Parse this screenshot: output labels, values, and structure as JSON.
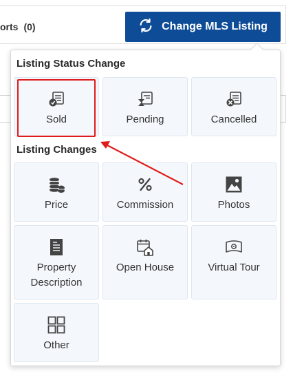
{
  "header": {
    "reports_label": "orts",
    "reports_count": "(0)",
    "change_button_label": "Change MLS Listing"
  },
  "popup": {
    "status_section_title": "Listing Status Change",
    "status_items": [
      {
        "label": "Sold",
        "icon": "sold-icon"
      },
      {
        "label": "Pending",
        "icon": "pending-icon"
      },
      {
        "label": "Cancelled",
        "icon": "cancelled-icon"
      }
    ],
    "changes_section_title": "Listing Changes",
    "change_items": [
      {
        "label": "Price",
        "icon": "coins-icon"
      },
      {
        "label": "Commission",
        "icon": "percent-icon"
      },
      {
        "label": "Photos",
        "icon": "photo-icon"
      },
      {
        "label": "Property\nDescription",
        "line1": "Property",
        "line2": "Description",
        "icon": "document-icon"
      },
      {
        "label": "Open House",
        "icon": "open-house-icon"
      },
      {
        "label": "Virtual Tour",
        "icon": "virtual-tour-icon"
      },
      {
        "label": "Other",
        "icon": "grid-icon"
      }
    ]
  },
  "colors": {
    "primary_button": "#0e4c97",
    "tile_bg": "#f4f8fc",
    "highlight": "#e01b1b"
  }
}
